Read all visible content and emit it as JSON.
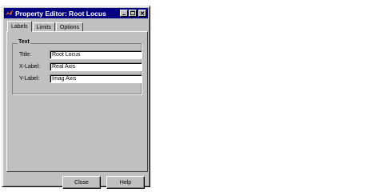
{
  "window": {
    "title": "Property Editor: Root Locus"
  },
  "tabs": [
    {
      "label": "Labels",
      "active": true
    },
    {
      "label": "Limits",
      "active": false
    },
    {
      "label": "Options",
      "active": false
    }
  ],
  "text_group": {
    "label": "Text",
    "fields": [
      {
        "label": "Title:",
        "value": "Root Locus"
      },
      {
        "label": "X-Label:",
        "value": "Real Axis"
      },
      {
        "label": "Y-Label:",
        "value": "Imag Axis"
      }
    ]
  },
  "buttons": {
    "close": "Close",
    "help": "Help"
  },
  "icons": {
    "app": "matlab-logo-icon",
    "minimize": "minimize-icon",
    "maximize": "maximize-icon",
    "close": "close-icon"
  },
  "colors": {
    "titlebar": "#000080",
    "face": "#c0c0c0",
    "app_icon": "#e87722"
  }
}
